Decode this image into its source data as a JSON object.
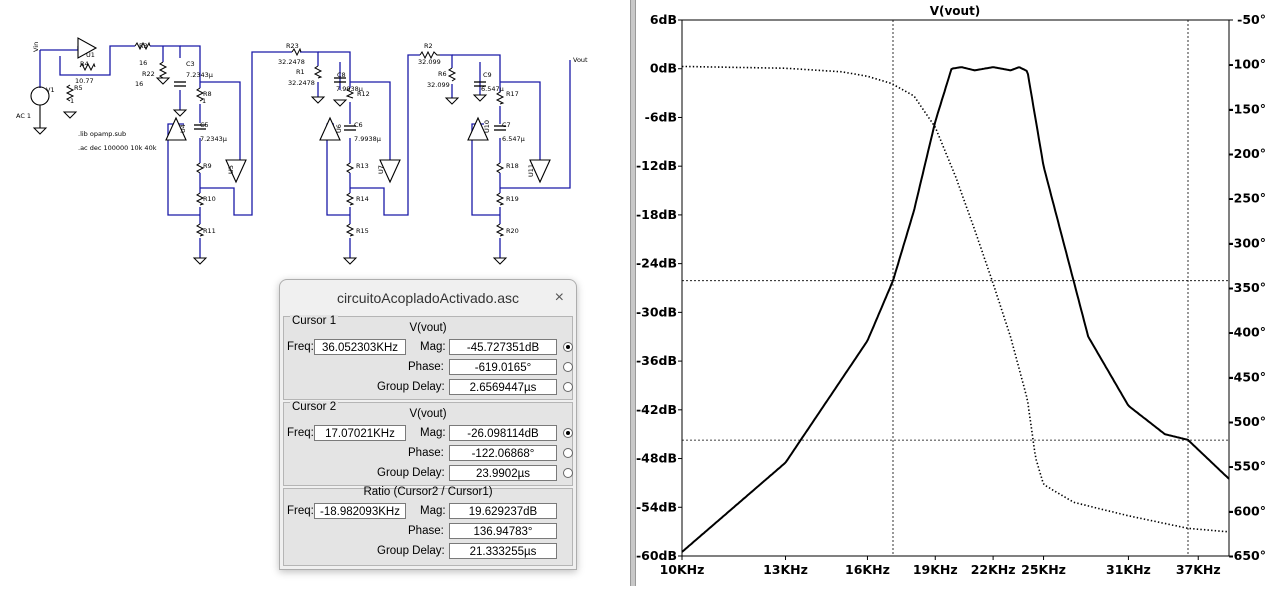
{
  "schematic": {
    "labels": {
      "vin": "Vin",
      "vout": "Vout",
      "u1": "U1",
      "v1": "V1",
      "ac1": "AC 1",
      "r3": "R3",
      "r3v": "16",
      "r22": "R22",
      "r22v": "16",
      "r4": "R4",
      "r4v": "10.77",
      "r5": "R5",
      "c3": "C3",
      "c3v": "7.2343µ",
      "r8": "R8",
      "c5": "C5",
      "c5v": "7.2343µ",
      "u4": "U4",
      "u5": "U5",
      "r9": "R9",
      "r10": "R10",
      "r11": "R11",
      "r23": "R23",
      "r23v": "32.2478",
      "r1": "R1",
      "r1v": "32.2478",
      "c8": "C8",
      "c8v": "7.9938µ",
      "r12": "R12",
      "c6": "C6",
      "c6v": "7.9938µ",
      "u6": "U6",
      "u7": "U7",
      "r13": "R13",
      "r14": "R14",
      "r15": "R15",
      "r2": "R2",
      "r2v": "32.099",
      "r6": "R6",
      "r6v": "32.099",
      "c9": "C9",
      "c9v": "6.547µ",
      "r17": "R17",
      "c7": "C7",
      "c7v": "6.547µ",
      "u10": "U10",
      "u11": "U11",
      "r18": "R18",
      "r19": "R19",
      "r20": "R20",
      "one": "1",
      "lib": ".lib opamp.sub",
      "ac": ".ac dec 100000 10k 40k"
    }
  },
  "plot": {
    "title": "V(vout)",
    "ylabels_left": [
      "6dB",
      "0dB",
      "-6dB",
      "-12dB",
      "-18dB",
      "-24dB",
      "-30dB",
      "-36dB",
      "-42dB",
      "-48dB",
      "-54dB",
      "-60dB"
    ],
    "ylabels_right": [
      "-50°",
      "-100°",
      "-150°",
      "-200°",
      "-250°",
      "-300°",
      "-350°",
      "-400°",
      "-450°",
      "-500°",
      "-550°",
      "-600°",
      "-650°"
    ],
    "xlabels": [
      "10KHz",
      "13KHz",
      "16KHz",
      "19KHz",
      "22KHz",
      "25KHz",
      "31KHz",
      "37KHz"
    ]
  },
  "chart_data": {
    "type": "line",
    "title": "V(vout)",
    "x_scale": "log",
    "xlim_hz": [
      10000,
      40000
    ],
    "ylim_db": [
      -60,
      6
    ],
    "ylim_deg": [
      -650,
      -50
    ],
    "series": [
      {
        "name": "",
        "unit": "dB",
        "x_khz": [
          10,
          13,
          16,
          17.07,
          18,
          19,
          19.8,
          20.3,
          21,
          22,
          23,
          23.5,
          24,
          25,
          28,
          31,
          34,
          36.05,
          40
        ],
        "values": [
          -59.5,
          -48.5,
          -33.5,
          -26.1,
          -17.5,
          -6.5,
          0,
          0.2,
          -0.2,
          0.2,
          -0.2,
          0.2,
          -0.3,
          -12,
          -33,
          -41.5,
          -45,
          -45.7,
          -50.5
        ]
      },
      {
        "name": "",
        "unit": "°",
        "x_khz": [
          10,
          13,
          15,
          16,
          17,
          17.07,
          18,
          19,
          20,
          21,
          22,
          23,
          24,
          24.5,
          25,
          27,
          31,
          36.05,
          40
        ],
        "values": [
          -102,
          -104,
          -108,
          -113,
          -121,
          -122.07,
          -135,
          -170,
          -225,
          -285,
          -345,
          -405,
          -475,
          -540,
          -570,
          -590,
          -605,
          -619.02,
          -623
        ]
      }
    ],
    "cursors": [
      {
        "x_khz": 17.07021,
        "mag_db": -26.098114
      },
      {
        "x_khz": 36.052303,
        "mag_db": -45.727351
      }
    ]
  },
  "cursor_window": {
    "title": "circuitoAcopladoActivado.asc",
    "close": "×",
    "c1": {
      "label": "Cursor 1",
      "signal": "V(vout)",
      "freq_label": "Freq:",
      "freq": "36.052303KHz",
      "mag_label": "Mag:",
      "mag": "-45.727351dB",
      "phase_label": "Phase:",
      "phase": "-619.0165°",
      "gd_label": "Group Delay:",
      "gd": "2.6569447µs"
    },
    "c2": {
      "label": "Cursor 2",
      "signal": "V(vout)",
      "freq_label": "Freq:",
      "freq": "17.07021KHz",
      "mag_label": "Mag:",
      "mag": "-26.098114dB",
      "phase_label": "Phase:",
      "phase": "-122.06868°",
      "gd_label": "Group Delay:",
      "gd": "23.9902µs"
    },
    "ratio": {
      "label": "Ratio (Cursor2 / Cursor1)",
      "freq_label": "Freq:",
      "freq": "-18.982093KHz",
      "mag_label": "Mag:",
      "mag": "19.629237dB",
      "phase_label": "Phase:",
      "phase": "136.94783°",
      "gd_label": "Group Delay:",
      "gd": "21.333255µs"
    }
  }
}
